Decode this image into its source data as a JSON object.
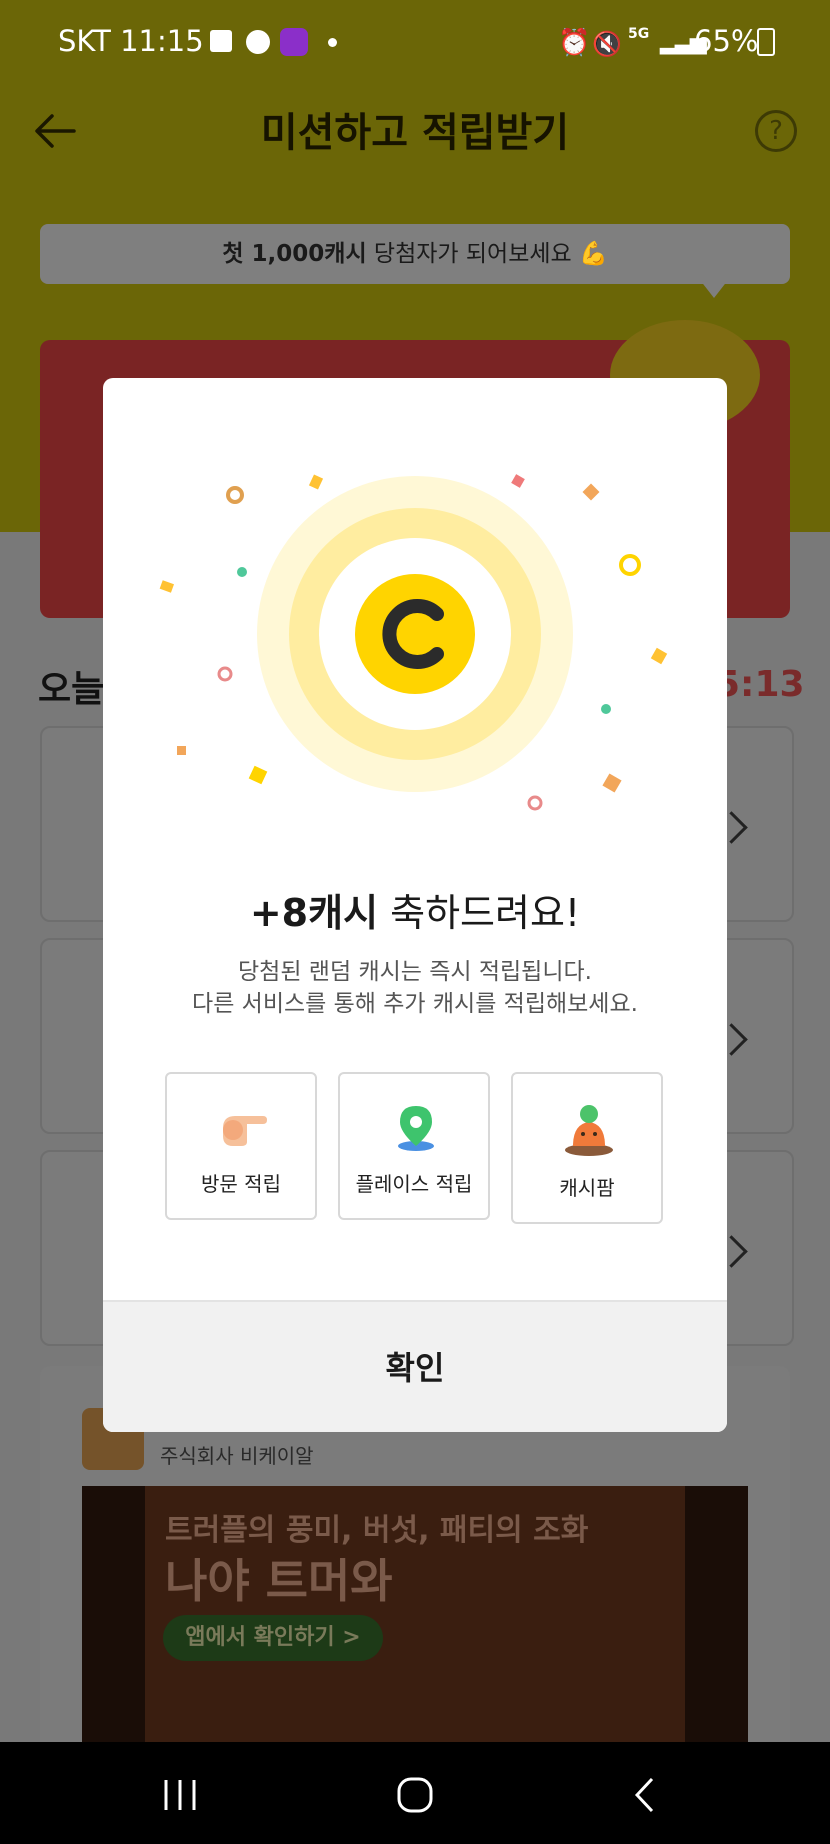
{
  "status_bar": {
    "carrier_time": "SKT 11:15",
    "battery": "65%",
    "network": "5G"
  },
  "header": {
    "title": "미션하고 적립받기",
    "back_icon": "back-arrow-icon",
    "help_icon": "help-icon",
    "help_text": "?"
  },
  "banner": {
    "bold": "첫 1,000캐시",
    "text": " 당첨자가 되어보세요 💪"
  },
  "today_section": {
    "label": "오늘",
    "timer": "5:13"
  },
  "ad": {
    "brand_name": "주식회사 비케이알",
    "line1": "트러플의 풍미, 버섯, 패티의 조화",
    "line2": "나야 트머와",
    "cta": "앱에서 확인하기 >"
  },
  "modal": {
    "title_bold": "+8캐시",
    "title_rest": " 축하드려요!",
    "desc_line1": "당첨된 랜덤 캐시는 즉시 적립됩니다.",
    "desc_line2": "다른 서비스를 통해 추가 캐시를 적립해보세요.",
    "options": [
      {
        "label": "방문 적립",
        "icon": "pointing-hand-icon"
      },
      {
        "label": "플레이스 적립",
        "icon": "map-pin-icon"
      },
      {
        "label": "캐시팜",
        "icon": "carrot-icon"
      }
    ],
    "confirm_label": "확인"
  },
  "colors": {
    "accent_yellow": "#ffd400",
    "modal_bg": "#ffffff"
  }
}
